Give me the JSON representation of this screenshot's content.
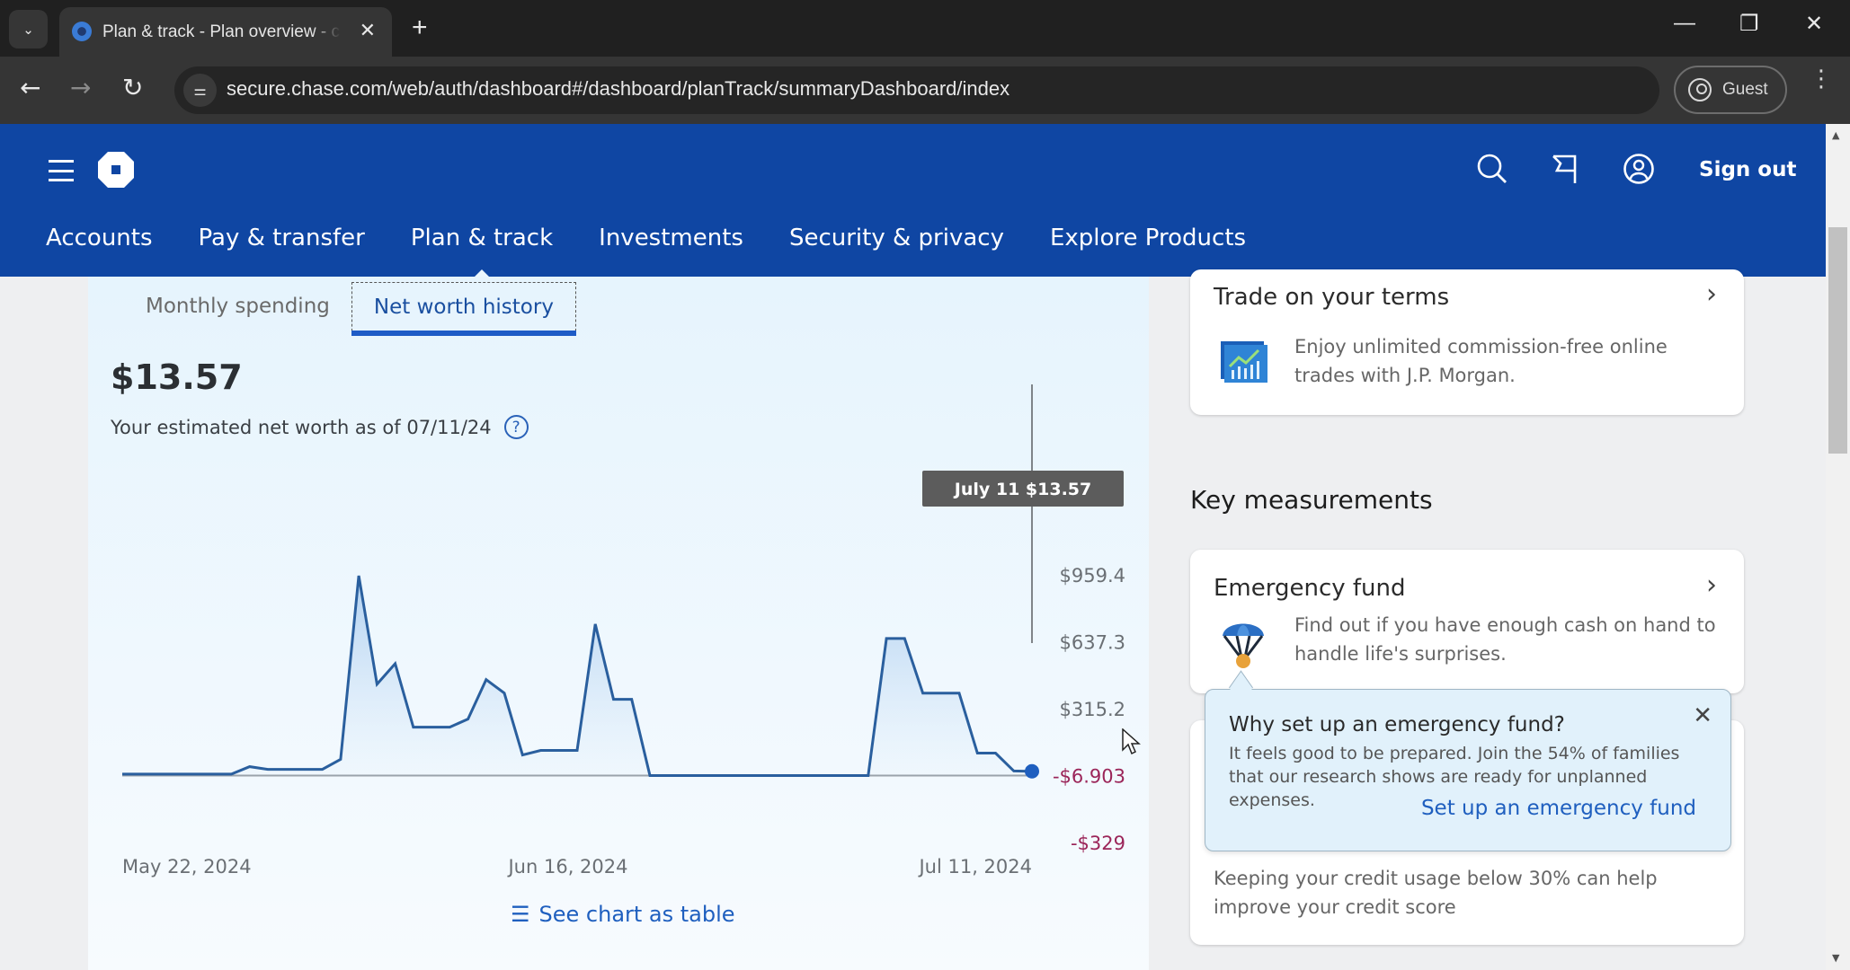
{
  "browser": {
    "tab_title": "Plan & track - Plan overview - c",
    "url": "secure.chase.com/web/auth/dashboard#/dashboard/planTrack/summaryDashboard/index",
    "profile_label": "Guest",
    "icons": {
      "tab_search": "chevron-down-icon",
      "close_tab": "close-icon",
      "new_tab": "plus-icon",
      "back": "arrow-left-icon",
      "forward": "arrow-right-icon",
      "reload": "reload-icon",
      "site_info": "tune-icon",
      "menu": "kebab-icon",
      "minimize": "minimize-icon",
      "restore": "restore-icon",
      "close_window": "close-icon"
    },
    "glyphs": {
      "tab_search": "⌄",
      "close": "✕",
      "new_tab": "+",
      "back": "←",
      "forward": "→",
      "reload": "↻",
      "site_info": "⚌",
      "minimize": "—",
      "restore": "❐",
      "menu": "⋮"
    }
  },
  "header": {
    "sign_out_label": "Sign out",
    "nav": [
      {
        "label": "Accounts",
        "active": false
      },
      {
        "label": "Pay & transfer",
        "active": false
      },
      {
        "label": "Plan & track",
        "active": true
      },
      {
        "label": "Investments",
        "active": false
      },
      {
        "label": "Security & privacy",
        "active": false
      },
      {
        "label": "Explore Products",
        "active": false
      }
    ],
    "brand_color": "#0f46a3"
  },
  "main": {
    "tabs": [
      {
        "label": "Monthly spending",
        "active": false
      },
      {
        "label": "Net worth history",
        "active": true
      }
    ],
    "net_worth": "$13.57",
    "net_worth_caption": "Your estimated net worth as of 07/11/24",
    "help_glyph": "?",
    "see_table_label": "See chart as table",
    "see_table_glyph": "☰"
  },
  "chart_data": {
    "type": "area",
    "title": "Net worth history",
    "xlabel": "",
    "ylabel": "",
    "x_tick_labels": [
      "May 22, 2024",
      "Jun 16, 2024",
      "Jul 11, 2024"
    ],
    "x_tick_index": [
      0,
      25,
      50
    ],
    "y_ticks": [
      959.4,
      637.3,
      315.2,
      -6.903,
      -329
    ],
    "y_tick_labels": [
      "$959.4",
      "$637.3",
      "$315.2",
      "-$6.903",
      "-$329"
    ],
    "ylim": [
      -329,
      959.4
    ],
    "baseline": -6.903,
    "grid": false,
    "tooltip": {
      "date": "July 11",
      "value": "$13.57"
    },
    "line_color": "#2a5f9e",
    "negative_label_color": "#9b2559",
    "x": [
      "May 22",
      "May 23",
      "May 24",
      "May 25",
      "May 26",
      "May 27",
      "May 28",
      "May 29",
      "May 30",
      "May 31",
      "Jun 1",
      "Jun 2",
      "Jun 3",
      "Jun 4",
      "Jun 5",
      "Jun 6",
      "Jun 7",
      "Jun 8",
      "Jun 9",
      "Jun 10",
      "Jun 11",
      "Jun 12",
      "Jun 13",
      "Jun 14",
      "Jun 15",
      "Jun 16",
      "Jun 17",
      "Jun 18",
      "Jun 19",
      "Jun 20",
      "Jun 21",
      "Jun 22",
      "Jun 23",
      "Jun 24",
      "Jun 25",
      "Jun 26",
      "Jun 27",
      "Jun 28",
      "Jun 29",
      "Jun 30",
      "Jul 1",
      "Jul 2",
      "Jul 3",
      "Jul 4",
      "Jul 5",
      "Jul 6",
      "Jul 7",
      "Jul 8",
      "Jul 9",
      "Jul 10",
      "Jul 11"
    ],
    "series": [
      {
        "name": "Net worth",
        "values": [
          0,
          0,
          0,
          0,
          0,
          0,
          0,
          36,
          23,
          23,
          23,
          23,
          71,
          955,
          433,
          532,
          226,
          226,
          226,
          265,
          455,
          390,
          92,
          114,
          114,
          114,
          722,
          360,
          360,
          -7,
          -7,
          -7,
          -7,
          -7,
          -7,
          -7,
          -7,
          -7,
          -7,
          -7,
          -7,
          -7,
          653,
          653,
          390,
          390,
          390,
          101,
          101,
          15,
          13.57
        ]
      }
    ]
  },
  "right": {
    "trade_card": {
      "title": "Trade on your terms",
      "description": "Enjoy unlimited commission-free online trades with J.P. Morgan.",
      "icon": "stock-chart-icon"
    },
    "key_measurements_title": "Key measurements",
    "emergency_card": {
      "title": "Emergency fund",
      "description": "Find out if you have enough cash on hand to handle life's surprises.",
      "icon": "parachute-icon"
    },
    "popover": {
      "title": "Why set up an emergency fund?",
      "body": "It feels good to be prepared. Join the 54% of families that our research shows are ready for unplanned expenses.",
      "link": "Set up an emergency fund"
    },
    "credit_card": {
      "description": "Keeping your credit usage below 30% can help improve your credit score"
    },
    "chevron_glyph": "›",
    "close_glyph": "✕"
  }
}
